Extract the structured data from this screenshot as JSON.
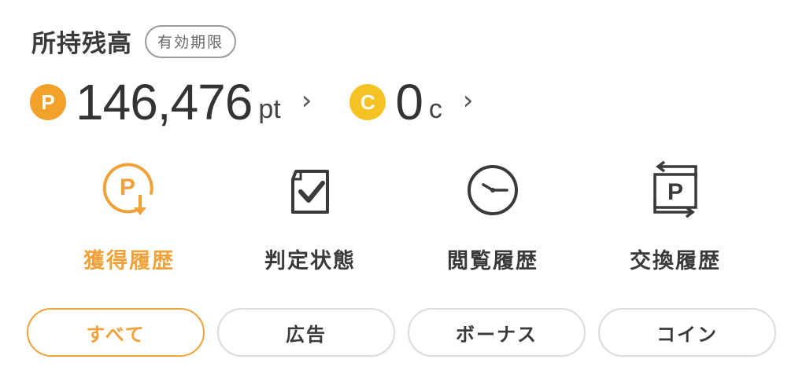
{
  "header": {
    "title": "所持残高",
    "expiry_label": "有効期限"
  },
  "balances": {
    "points": {
      "icon_letter": "P",
      "value": "146,476",
      "unit": "pt",
      "chevron": "›"
    },
    "coins": {
      "icon_letter": "C",
      "value": "0",
      "unit": "c",
      "chevron": "›"
    }
  },
  "menu": [
    {
      "label": "獲得履歴",
      "icon": "point-earn-icon",
      "active": true
    },
    {
      "label": "判定状態",
      "icon": "document-check-icon",
      "active": false
    },
    {
      "label": "閲覧履歴",
      "icon": "clock-icon",
      "active": false
    },
    {
      "label": "交換履歴",
      "icon": "point-exchange-icon",
      "active": false
    }
  ],
  "tabs": [
    {
      "label": "すべて",
      "active": true
    },
    {
      "label": "広告",
      "active": false
    },
    {
      "label": "ボーナス",
      "active": false
    },
    {
      "label": "コイン",
      "active": false
    }
  ],
  "colors": {
    "accent": "#f0a23a",
    "point_coin": "#f2a12a",
    "coin": "#f6c223",
    "text": "#3a3a3a"
  }
}
